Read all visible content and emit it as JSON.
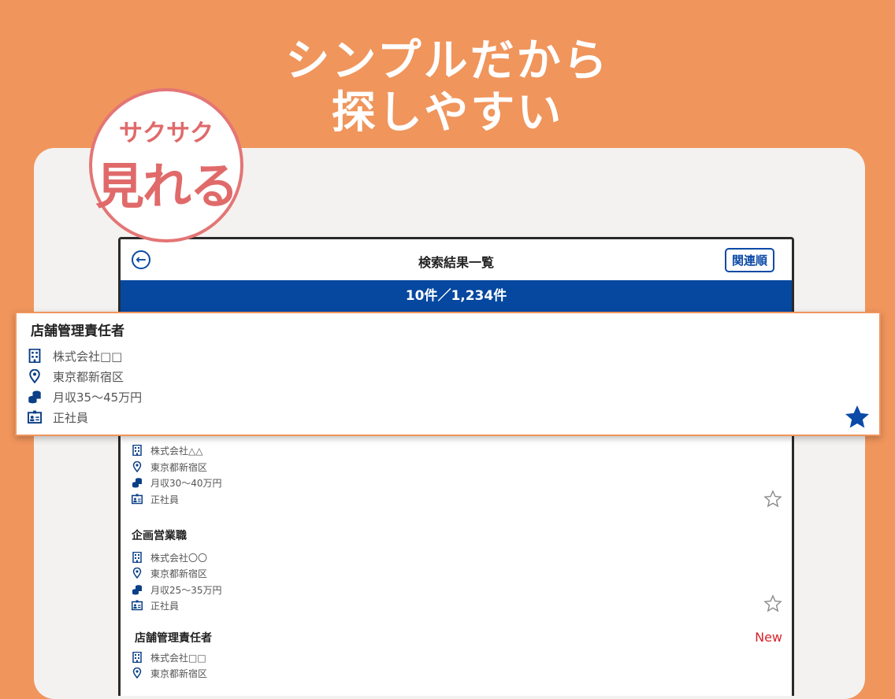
{
  "headline": {
    "line1": "シンプルだから",
    "line2": "探しやすい"
  },
  "badge": {
    "top": "サクサク",
    "bottom": "見れる"
  },
  "app": {
    "nav": {
      "title": "検索結果一覧",
      "sort_label": "関連順",
      "back_glyph": "←"
    },
    "count": "10件／1,234件",
    "highlighted": {
      "title": "店舗管理責任者",
      "company": "株式会社□□",
      "location": "東京都新宿区",
      "salary": "月収35〜45万円",
      "employment": "正社員",
      "favorite": true
    },
    "listings": [
      {
        "title": "",
        "company": "株式会社△△",
        "location": "東京都新宿区",
        "salary": "月収30〜40万円",
        "employment": "正社員",
        "favorite": false,
        "badge": ""
      },
      {
        "title": "企画営業職",
        "company": "株式会社〇〇",
        "location": "東京都新宿区",
        "salary": "月収25〜35万円",
        "employment": "正社員",
        "favorite": false,
        "badge": ""
      },
      {
        "title": "店舗管理責任者",
        "company": "株式会社□□",
        "location": "東京都新宿区",
        "salary": "",
        "employment": "",
        "favorite": false,
        "badge": "New"
      }
    ]
  },
  "colors": {
    "background": "#f0955c",
    "brand_blue": "#0648a0",
    "badge_red": "#e06a6a",
    "new_red": "#d8232a"
  },
  "icons": [
    "building-icon",
    "location-pin-icon",
    "coins-icon",
    "id-card-icon",
    "star-outline-icon",
    "star-filled-icon",
    "back-arrow-icon"
  ]
}
